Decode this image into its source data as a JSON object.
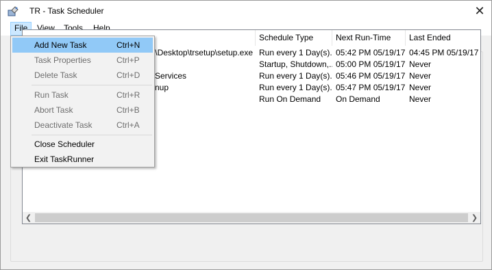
{
  "window": {
    "title": "TR - Task Scheduler",
    "close_glyph": "✕"
  },
  "menubar": {
    "items": [
      {
        "label": "File"
      },
      {
        "label": "View"
      },
      {
        "label": "Tools"
      },
      {
        "label": "Help"
      }
    ]
  },
  "listview": {
    "columns": [
      {
        "label": ""
      },
      {
        "label": "Schedule Type"
      },
      {
        "label": "Next Run-Time"
      },
      {
        "label": "Last Ended"
      }
    ],
    "rows": [
      {
        "path": "s\\Desktop\\trsetup\\setup.exe",
        "schedule": "Run every 1 Day(s).",
        "next": "05:42 PM 05/19/17",
        "last": "04:45 PM 05/19/17"
      },
      {
        "path": "",
        "schedule": "Startup, Shutdown,...",
        "next": "05:00 PM 05/19/17",
        "last": "Never"
      },
      {
        "path": "Services",
        "schedule": "Run every 1 Day(s).",
        "next": "05:46 PM 05/19/17",
        "last": "Never"
      },
      {
        "path": "nup",
        "schedule": "Run every 1 Day(s).",
        "next": "05:47 PM 05/19/17",
        "last": "Never"
      },
      {
        "path": "",
        "schedule": "Run On Demand",
        "next": "On Demand",
        "last": "Never"
      }
    ]
  },
  "file_menu": {
    "items": [
      {
        "label": "Add New Task",
        "shortcut": "Ctrl+N",
        "enabled": true,
        "highlighted": true
      },
      {
        "label": "Task Properties",
        "shortcut": "Ctrl+P",
        "enabled": false
      },
      {
        "label": "Delete Task",
        "shortcut": "Ctrl+D",
        "enabled": false
      },
      {
        "label": "Run Task",
        "shortcut": "Ctrl+R",
        "enabled": false
      },
      {
        "label": "Abort Task",
        "shortcut": "Ctrl+B",
        "enabled": false
      },
      {
        "label": "Deactivate Task",
        "shortcut": "Ctrl+A",
        "enabled": false
      },
      {
        "label": "Close Scheduler",
        "shortcut": "",
        "enabled": true
      },
      {
        "label": "Exit TaskRunner",
        "shortcut": "",
        "enabled": true
      }
    ]
  },
  "colors": {
    "menu_highlight": "#91c9f7",
    "menubar_active": "#cce8ff",
    "disabled_text": "#6d6d6d",
    "window_bg": "#f0f0f0"
  }
}
